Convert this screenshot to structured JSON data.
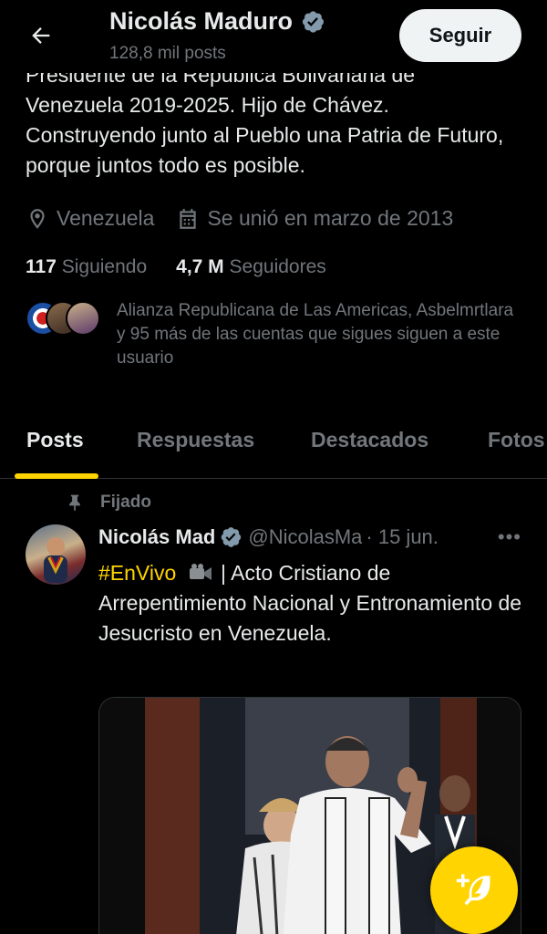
{
  "header": {
    "name": "Nicolás Maduro",
    "post_count": "128,8 mil posts",
    "follow_label": "Seguir"
  },
  "bio": {
    "cut_line": "Presidente de la República Bolivariana de",
    "text": "Venezuela 2019-2025. Hijo de Chávez. Construyendo junto al Pueblo una Patria de Futuro, porque juntos todo es posible."
  },
  "meta": {
    "location": "Venezuela",
    "joined": "Se unió en marzo de 2013"
  },
  "stats": {
    "following_count": "117",
    "following_label": "Siguiendo",
    "followers_count": "4,7 M",
    "followers_label": "Seguidores"
  },
  "followed_by": {
    "text": "Alianza Republicana de Las Americas, Asbelmrtlara y 95 más de las cuentas que sigues siguen a este usuario"
  },
  "tabs": [
    {
      "label": "Posts",
      "active": true
    },
    {
      "label": "Respuestas",
      "active": false
    },
    {
      "label": "Destacados",
      "active": false
    },
    {
      "label": "Fotos",
      "active": false
    }
  ],
  "post": {
    "pinned_label": "Fijado",
    "name": "Nicolás Mad",
    "handle": "@NicolasMa",
    "time": "· 15 jun.",
    "more": "•••",
    "hashtag": "#EnVivo",
    "text": " | Acto Cristiano de Arrepentimiento Nacional y Entronamiento de Jesucristo en Venezuela."
  },
  "icons": {
    "back": "arrow-left-icon",
    "verified": "verified-badge-icon",
    "location": "location-pin-icon",
    "calendar": "calendar-icon",
    "pin": "pin-icon",
    "camera": "video-camera-icon",
    "compose": "compose-feather-icon"
  },
  "colors": {
    "accent": "#ffd400",
    "background": "#000000",
    "text": "#e7e9ea",
    "secondary": "#71767b",
    "verified": "#829aab"
  }
}
